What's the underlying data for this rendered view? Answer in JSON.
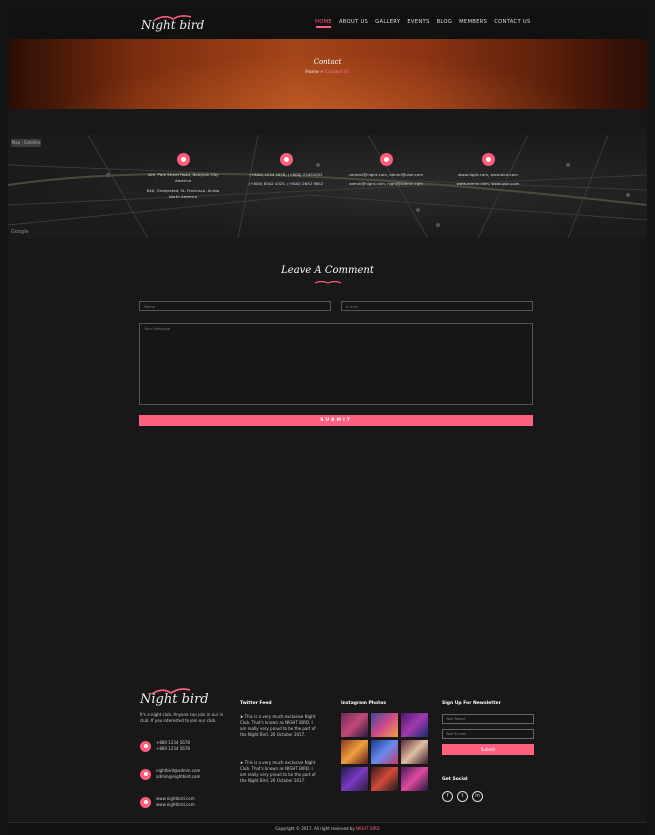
{
  "brand": {
    "logo_text": "Night bird",
    "accent": "#ff5c7c"
  },
  "nav": {
    "items": [
      "HOME",
      "ABOUT US",
      "GALLERY",
      "EVENTS",
      "BLOG",
      "MEMBERS",
      "CONTACT US"
    ],
    "active_index": 0
  },
  "hero": {
    "title": "Contact",
    "crumb_home": "Home",
    "crumb_sep": "»",
    "crumb_current": "Contact Us"
  },
  "map": {
    "chip": "Map · Satellite",
    "attribution": "Google"
  },
  "info_blocks": [
    {
      "icon": "location-icon",
      "lines": [
        "405, Park Street Road, Newyork City",
        "America",
        "",
        "840, Oranjestad, St. Francisco, Aruba",
        "North America"
      ]
    },
    {
      "icon": "phone-icon",
      "lines": [
        "(+800) 1234 5678, (+800) 23451052",
        "(+800) 8502 4325, (+800) 2652 9852"
      ]
    },
    {
      "icon": "email-icon",
      "lines": [
        "contact@night.com, admin@user.com",
        "admin@night.com, night@admin.com"
      ]
    },
    {
      "icon": "globe-icon",
      "lines": [
        "www.night.com, www.bird.com",
        "www.admin.com, www.user.com"
      ]
    }
  ],
  "comment": {
    "title": "Leave A Comment",
    "name_placeholder": "Name",
    "email_placeholder": "E-mail",
    "message_placeholder": "Your Message",
    "submit": "SUBMIT"
  },
  "footer": {
    "about": "It's a night club, Anyone can join in our in club. If you interested to join our club.",
    "contacts": [
      {
        "icon": "phone-icon",
        "lines": [
          "+880 1234 5678",
          "+880 1234 5678"
        ]
      },
      {
        "icon": "email-icon",
        "lines": [
          "nightbird@admin.com",
          "admin@nightbird.com"
        ]
      },
      {
        "icon": "globe-icon",
        "lines": [
          "www.nightbird.com",
          "www.nightbird.com"
        ]
      }
    ],
    "twitter_title": "Twitter Feed",
    "tweets": [
      {
        "text": "This is a very much exclusive Night Club. That's known as NIGHT BIRD. I am really very proud to be the part of the Night Bird. 26 October 2017.",
        "date": "26 October 2017."
      },
      {
        "text": "This is a very much exclusive Night Club. That's known as NIGHT BIRD. I am really very proud to be the part of the Night Bird. 26 October 2017.",
        "date": "26 October 2017."
      }
    ],
    "instagram_title": "Instagram Photos",
    "newsletter_title": "Sign Up For Newsletter",
    "newsletter_name": "Your Name",
    "newsletter_email": "Your E-mail",
    "newsletter_button": "Submit",
    "social_title": "Get Social",
    "social": [
      "f",
      "t",
      "in"
    ]
  },
  "copyright": {
    "text": "Copyright © 2017. All right reserved by",
    "brand": "NIGHT BIRD"
  }
}
